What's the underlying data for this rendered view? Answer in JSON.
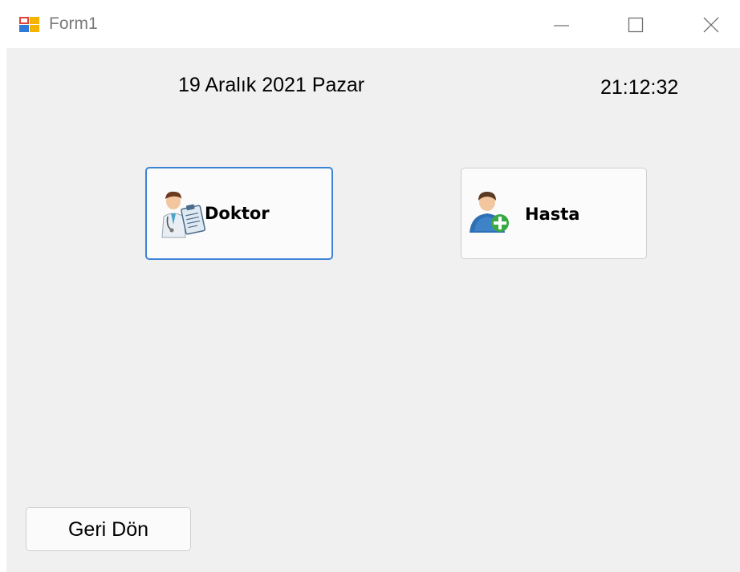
{
  "window": {
    "title": "Form1",
    "icons": [
      "app-icon",
      "minimize-icon",
      "maximize-icon",
      "close-icon"
    ]
  },
  "header": {
    "date": "19 Aralık 2021 Pazar",
    "time": "21:12:32"
  },
  "buttons": {
    "doktor": {
      "label": "Doktor",
      "icon": "doctor-icon"
    },
    "hasta": {
      "label": "Hasta",
      "icon": "add-patient-icon"
    },
    "back": {
      "label": "Geri Dön"
    }
  },
  "colors": {
    "client_bg": "#f0f0f0",
    "focus_border": "#3b83d6"
  }
}
